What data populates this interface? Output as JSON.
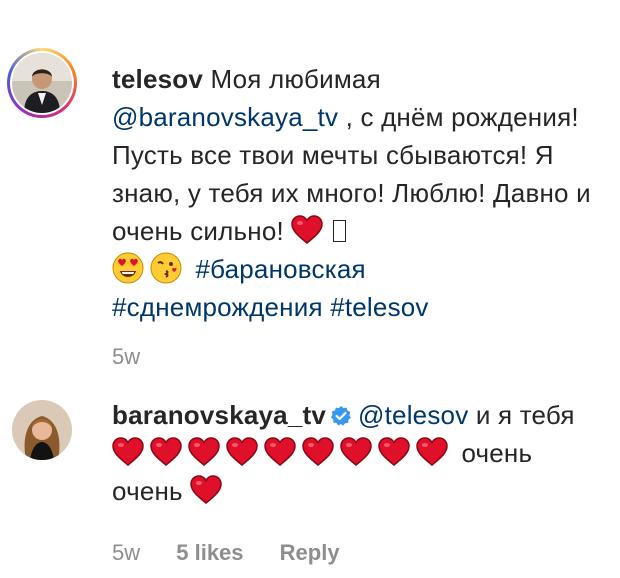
{
  "comments": [
    {
      "username": "telesov",
      "text_1": "Моя любимая",
      "mention": "@baranovskaya_tv",
      "text_2": ", с днём рождения! Пусть все твои мечты сбываются! Я знаю, у тебя их много! Люблю! Давно и очень сильно!",
      "hashtags": [
        "#барановская",
        "#сднемрождения",
        "#telesov"
      ],
      "time": "5w"
    },
    {
      "username": "baranovskaya_tv",
      "mention": "@telesov",
      "text_1": "и я тебя",
      "text_2": "очень",
      "text_3": "очень",
      "time": "5w",
      "likes": "5 likes",
      "reply": "Reply"
    }
  ],
  "colors": {
    "text": "#262626",
    "link": "#00376b",
    "meta": "#8e8e8e",
    "heart": "#e0102a",
    "verified": "#3897f0"
  },
  "icons": [
    "heart-emoji",
    "heart-eyes-emoji",
    "kissing-face-emoji",
    "verified-badge-icon"
  ]
}
